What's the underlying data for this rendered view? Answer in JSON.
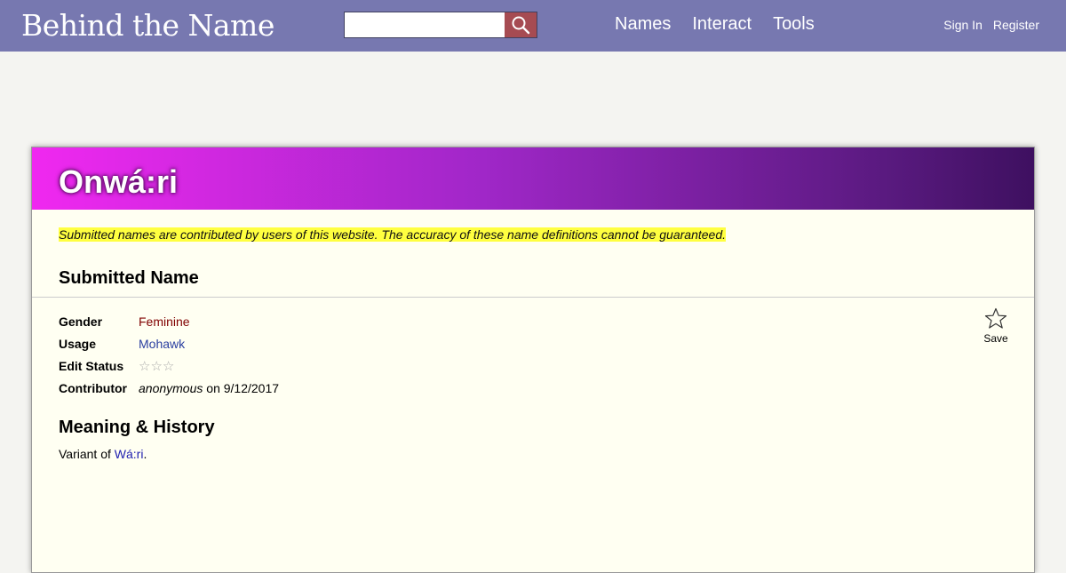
{
  "header": {
    "logo_text": "Behind the Name",
    "search": {
      "value": "",
      "placeholder": ""
    },
    "nav": [
      "Names",
      "Interact",
      "Tools"
    ],
    "account": {
      "sign_in": "Sign In",
      "register": "Register"
    },
    "colors": {
      "bar": "#7778b0",
      "search_button": "#a64b52"
    }
  },
  "page": {
    "name": "Onwá:ri",
    "disclaimer": "Submitted names are contributed by users of this website. The accuracy of these name definitions cannot be guaranteed.",
    "section_title": "Submitted Name",
    "details": {
      "gender_label": "Gender",
      "gender_value": "Feminine",
      "usage_label": "Usage",
      "usage_value": "Mohawk",
      "edit_status_label": "Edit Status",
      "edit_status_stars": "☆☆☆",
      "contributor_label": "Contributor",
      "contributor_name": "anonymous",
      "contributor_on": " on 9/12/2017"
    },
    "save_label": "Save",
    "meaning_title": "Meaning & History",
    "meaning": {
      "prefix": "Variant of ",
      "link": "Wá:ri",
      "suffix": "."
    }
  }
}
